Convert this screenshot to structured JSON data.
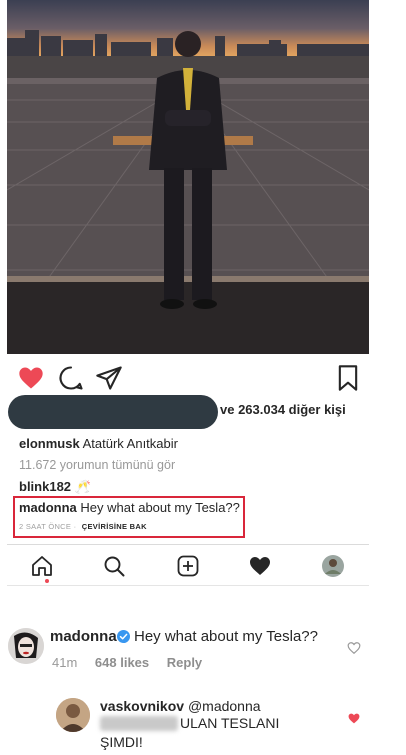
{
  "colors": {
    "like_red": "#ed4956",
    "highlight_box": "#d9263a",
    "muted_text": "#999999"
  },
  "post": {
    "photo_icon": "photo-of-man-in-suit-at-anitkabir",
    "likes_text": "ve 263.034 diğer kişi",
    "caption": {
      "user": "elonmusk",
      "text": "Atatürk Anıtkabir"
    },
    "view_all_comments": "11.672 yorumun tümünü gör",
    "comments": [
      {
        "user": "blink182",
        "text": "🥂"
      },
      {
        "user": "madonna",
        "text": "Hey what about my Tesla??",
        "time": "2 SAAT ÖNCE ·",
        "translate": "ÇEVİRİSİNE BAK"
      }
    ]
  },
  "tabbar": {
    "icons": [
      "home-icon",
      "search-icon",
      "add-icon",
      "heart-icon",
      "profile-icon"
    ],
    "active": "home-icon"
  },
  "comment_thread": {
    "top": {
      "user": "madonna",
      "verified": true,
      "text": "Hey what about my Tesla??",
      "time": "41m",
      "likes": "648 likes",
      "reply": "Reply"
    },
    "reply": {
      "user": "vaskovnikov",
      "mention": "@madonna",
      "text_line1": "ULAN TESLANI",
      "text_line2": "ŞIMDI!"
    }
  }
}
